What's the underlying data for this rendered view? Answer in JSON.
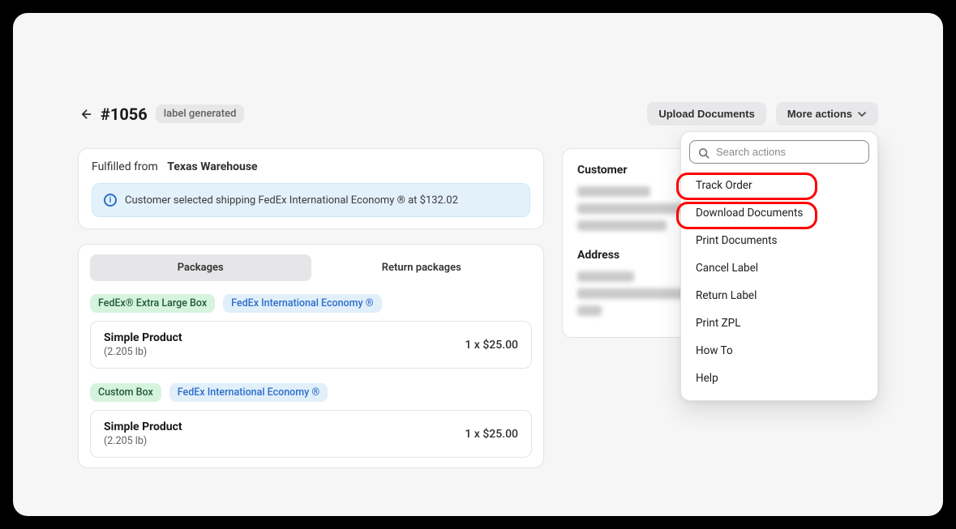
{
  "header": {
    "order_title": "#1056",
    "status": "label generated",
    "upload_btn": "Upload Documents",
    "more_actions_btn": "More actions"
  },
  "fulfillment": {
    "prefix": "Fulfilled from",
    "location": "Texas Warehouse",
    "info_text": "Customer selected shipping FedEx International Economy ®  at  $132.02"
  },
  "tabs": {
    "packages": "Packages",
    "return_packages": "Return packages"
  },
  "packages": [
    {
      "box_chip": "FedEx® Extra Large Box",
      "service_chip": "FedEx International Economy ®",
      "product_name": "Simple Product",
      "product_meta": "(2.205 lb)",
      "price_line": "1 x $25.00"
    },
    {
      "box_chip": "Custom Box",
      "service_chip": "FedEx International Economy ®",
      "product_name": "Simple Product",
      "product_meta": "(2.205 lb)",
      "price_line": "1 x $25.00"
    }
  ],
  "side": {
    "customer_heading": "Customer",
    "address_heading": "Address"
  },
  "actions_menu": {
    "search_placeholder": "Search actions",
    "items": [
      "Track Order",
      "Download Documents",
      "Print Documents",
      "Cancel Label",
      "Return Label",
      "Print ZPL",
      "How To",
      "Help"
    ]
  }
}
